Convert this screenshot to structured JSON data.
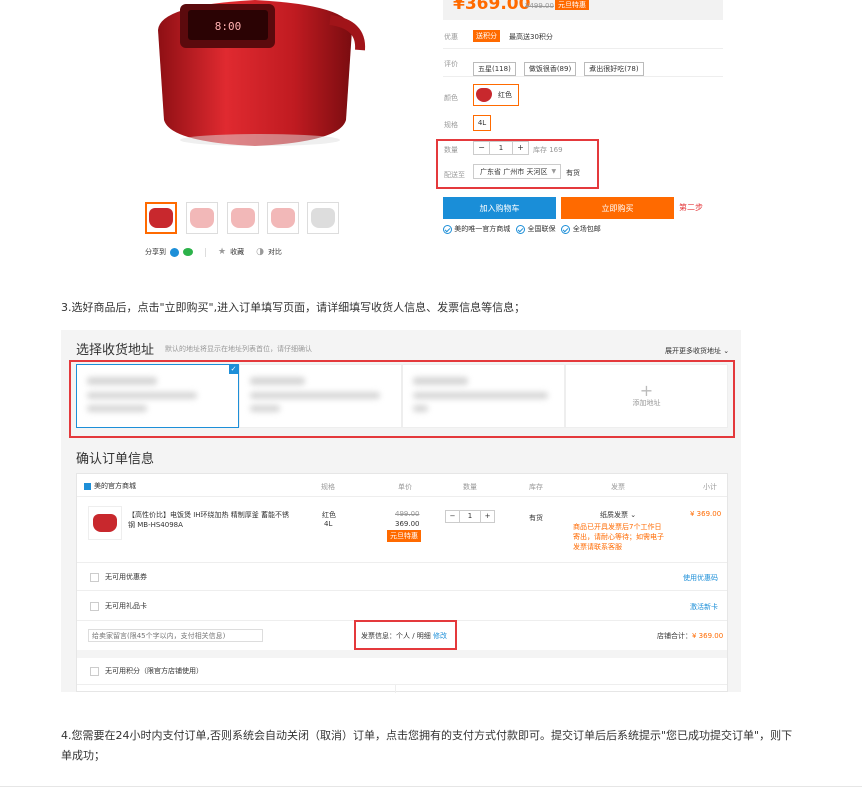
{
  "product": {
    "price": "¥369.00",
    "original_price": "¥499.00",
    "price_badge": "元旦特惠",
    "promo_label": "优惠",
    "promo_tag": "送积分",
    "promo_text": "最高送30积分",
    "review_label": "评价",
    "review_tags": [
      "五星(118)",
      "做饭很香(89)",
      "煮出很好吃(78)"
    ],
    "color_label": "颜色",
    "color_value": "红色",
    "spec_label": "规格",
    "spec_value": "4L",
    "qty_label": "数量",
    "qty_minus": "−",
    "qty_value": "1",
    "qty_plus": "+",
    "stock_text": "库存 169",
    "ship_label": "配送至",
    "ship_value": "广东省 广州市 天河区",
    "ship_status": "有货",
    "add_cart": "加入购物车",
    "buy_now": "立即购买",
    "step_note": "第二步",
    "guarantees": [
      "美的唯一官方商城",
      "全国联保",
      "全场包邮"
    ],
    "share_label": "分享到",
    "favorite_label": "收藏",
    "compare_label": "对比"
  },
  "instructions": {
    "step3": "3.选好商品后，点击\"立即购买\",进入订单填写页面，请详细填写收货人信息、发票信息等信息；",
    "step4": "4.您需要在24小时内支付订单,否则系统会自动关闭（取消）订单，点击您拥有的支付方式付款即可。提交订单后后系统提示\"您已成功提交订单\"，则下单成功；"
  },
  "checkout": {
    "address_title": "选择收货地址",
    "address_hint": "默认的地址将显示在地址列表首位，请仔细确认",
    "address_expand": "展开更多收货地址",
    "add_address": "添加地址",
    "order_title": "确认订单信息",
    "table_headers": [
      "规格",
      "单价",
      "数量",
      "库存",
      "发票",
      "小计"
    ],
    "store_name": "美的官方商城",
    "item": {
      "name": "【高性价比】电饭煲 IH环绕加热 精制厚釜 蓄能不锈钢 MB-HS4098A",
      "spec_color": "红色",
      "spec_size": "4L",
      "old_price": "499.00",
      "price": "369.00",
      "badge": "元旦特惠",
      "qty": "1",
      "stock": "有货",
      "invoice_type": "纸质发票",
      "invoice_note": "商品已开具发票后7个工作日寄出，请耐心等待；如需电子发票请联系客服",
      "subtotal": "¥ 369.00"
    },
    "coupon_label": "无可用优惠券",
    "coupon_link": "使用优惠码",
    "gift_card_label": "无可用礼品卡",
    "gift_card_link": "激活新卡",
    "message_placeholder": "给卖家留言(限45个字以内，支付相关信息)",
    "invoice_info_label": "发票信息：个人 / 明细",
    "invoice_edit": "修改",
    "store_total_label": "店铺合计：",
    "store_total": "¥ 369.00",
    "points_label": "无可用积分（限官方店铺使用）"
  }
}
